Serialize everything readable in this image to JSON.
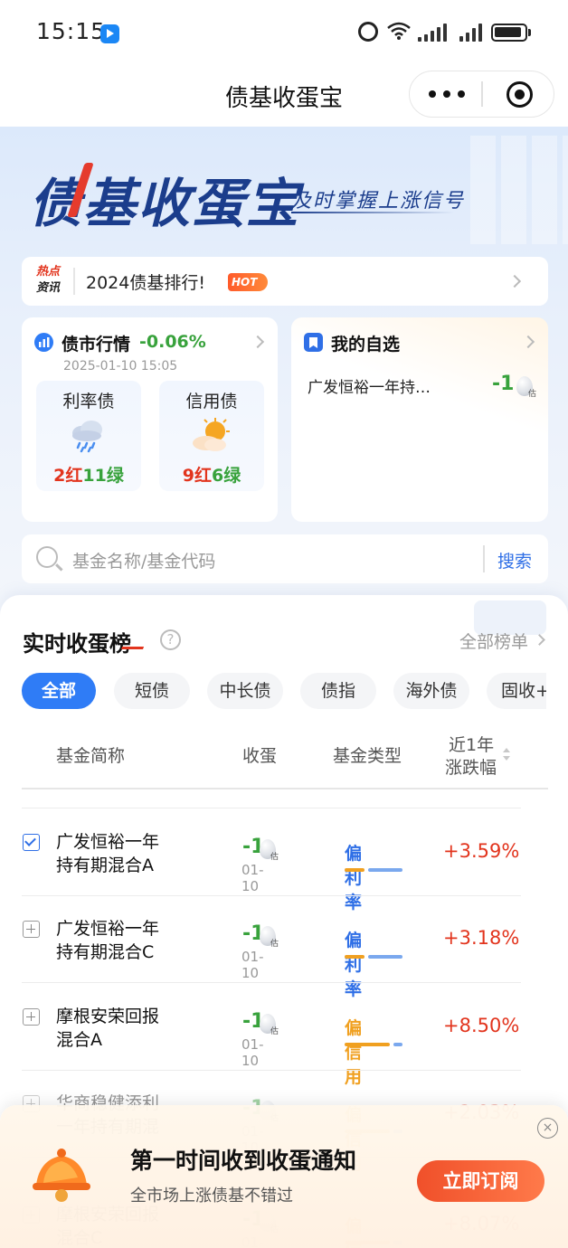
{
  "status_bar": {
    "time": "15:15"
  },
  "nav": {
    "title": "债基收蛋宝"
  },
  "hero": {
    "brand": "债基收蛋宝",
    "slogan": "及时掌握上涨信号"
  },
  "news": {
    "tag_line1": "热点",
    "tag_line2": "资讯",
    "text": "2024债基排行!",
    "badge": "HOT"
  },
  "market": {
    "title": "债市行情",
    "change": "-0.06%",
    "date": "2025-01-10 15:05",
    "rate": {
      "label": "利率债",
      "red": "2红",
      "green": "11绿"
    },
    "credit": {
      "label": "信用债",
      "red": "9红",
      "green": "6绿"
    }
  },
  "favorites": {
    "title": "我的自选",
    "fund": "广发恒裕一年持…",
    "value": "-1",
    "est": "估"
  },
  "search": {
    "placeholder": "基金名称/基金代码",
    "button": "搜索"
  },
  "ranking": {
    "title": "实时收蛋榜",
    "help": "?",
    "all_link": "全部榜单",
    "tabs": [
      "全部",
      "短债",
      "中长债",
      "债指",
      "海外债",
      "固收+"
    ],
    "headers": {
      "name": "基金简称",
      "egg": "收蛋",
      "type": "基金类型",
      "change_line1": "近1年",
      "change_line2": "涨跌幅"
    },
    "rows": [
      {
        "name1": "广发恒裕一年",
        "name2": "持有期混合A",
        "egg": "-1",
        "est": "估",
        "date": "01-10",
        "type": "偏利率",
        "change": "+3.59%"
      },
      {
        "name1": "广发恒裕一年",
        "name2": "持有期混合C",
        "egg": "-1",
        "est": "估",
        "date": "01-10",
        "type": "偏利率",
        "change": "+3.18%"
      },
      {
        "name1": "摩根安荣回报",
        "name2": "混合A",
        "egg": "-1",
        "est": "估",
        "date": "01-10",
        "type": "偏信用",
        "change": "+8.50%"
      },
      {
        "name1": "华商稳健添利",
        "name2": "一年持有期混",
        "egg": "-1",
        "est": "估",
        "date": "01-10",
        "type": "偏信用",
        "change": "+2.03%"
      },
      {
        "name1": "摩根安荣回报",
        "name2": "混合C",
        "egg": "-1",
        "est": "估",
        "date": "01-10",
        "type": "偏信用",
        "change": "+8.07%"
      }
    ]
  },
  "popup": {
    "title": "第一时间收到收蛋通知",
    "subtitle": "全市场上涨债基不错过",
    "button": "立即订阅",
    "close": "×"
  },
  "colors": {
    "accent": "#2f7cf6",
    "up": "#e2341d",
    "down": "#38a23c",
    "rate_type": "#2f6fe6",
    "credit_type": "#f0a020"
  }
}
